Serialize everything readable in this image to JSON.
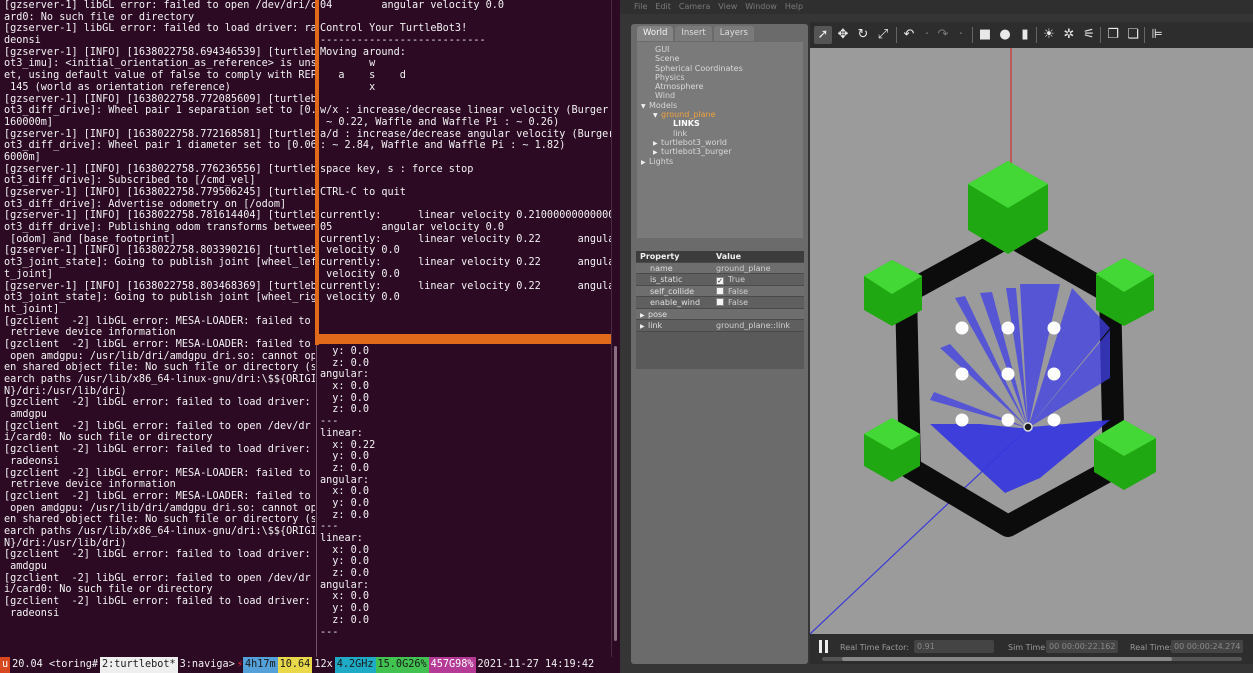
{
  "terminal": {
    "left_pane": [
      "[gzserver-1] libGL error: failed to open /dev/dri/c",
      "ard0: No such file or directory",
      "[gzserver-1] libGL error: failed to load driver: ra",
      "deonsi",
      "[gzserver-1] [INFO] [1638022758.694346539] [turtleb",
      "ot3_imu]: <initial_orientation_as_reference> is uns",
      "et, using default value of false to comply with REP",
      " 145 (world as orientation reference)",
      "[gzserver-1] [INFO] [1638022758.772085609] [turtleb",
      "ot3_diff_drive]: Wheel pair 1 separation set to [0.",
      "160000m]",
      "[gzserver-1] [INFO] [1638022758.772168581] [turtleb",
      "ot3_diff_drive]: Wheel pair 1 diameter set to [0.06",
      "6000m]",
      "[gzserver-1] [INFO] [1638022758.776236556] [turtleb",
      "ot3_diff_drive]: Subscribed to [/cmd_vel]",
      "[gzserver-1] [INFO] [1638022758.779506245] [turtleb",
      "ot3_diff_drive]: Advertise odometry on [/odom]",
      "[gzserver-1] [INFO] [1638022758.781614404] [turtleb",
      "ot3_diff_drive]: Publishing odom transforms between",
      " [odom] and [base_footprint]",
      "[gzserver-1] [INFO] [1638022758.803390216] [turtleb",
      "ot3_joint_state]: Going to publish joint [wheel_lef",
      "t_joint]",
      "[gzserver-1] [INFO] [1638022758.803468369] [turtleb",
      "ot3_joint_state]: Going to publish joint [wheel_rig",
      "ht_joint]",
      "[gzclient  -2] libGL error: MESA-LOADER: failed to",
      " retrieve device information",
      "[gzclient  -2] libGL error: MESA-LOADER: failed to",
      " open amdgpu: /usr/lib/dri/amdgpu_dri.so: cannot op",
      "en shared object file: No such file or directory (s",
      "earch paths /usr/lib/x86_64-linux-gnu/dri:\\$${ORIGI",
      "N}/dri:/usr/lib/dri)",
      "[gzclient  -2] libGL error: failed to load driver:",
      " amdgpu",
      "[gzclient  -2] libGL error: failed to open /dev/dr",
      "i/card0: No such file or directory",
      "[gzclient  -2] libGL error: failed to load driver:",
      " radeonsi",
      "[gzclient  -2] libGL error: MESA-LOADER: failed to",
      " retrieve device information",
      "[gzclient  -2] libGL error: MESA-LOADER: failed to",
      " open amdgpu: /usr/lib/dri/amdgpu_dri.so: cannot op",
      "en shared object file: No such file or directory (s",
      "earch paths /usr/lib/x86_64-linux-gnu/dri:\\$${ORIGI",
      "N}/dri:/usr/lib/dri)",
      "[gzclient  -2] libGL error: failed to load driver:",
      " amdgpu",
      "[gzclient  -2] libGL error: failed to open /dev/dr",
      "i/card0: No such file or directory",
      "[gzclient  -2] libGL error: failed to load driver:",
      " radeonsi"
    ],
    "right_top_pane": [
      "04        angular velocity 0.0",
      "",
      "Control Your TurtleBot3!",
      "---------------------------",
      "Moving around:",
      "        w",
      "   a    s    d",
      "        x",
      "",
      "w/x : increase/decrease linear velocity (Burger :",
      " ~ 0.22, Waffle and Waffle Pi : ~ 0.26)",
      "a/d : increase/decrease angular velocity (Burger",
      ": ~ 2.84, Waffle and Waffle Pi : ~ 1.82)",
      "",
      "space key, s : force stop",
      "",
      "CTRL-C to quit",
      "",
      "currently:      linear velocity 0.210000000000000",
      "05        angular velocity 0.0",
      "currently:      linear velocity 0.22      angular",
      " velocity 0.0",
      "currently:      linear velocity 0.22      angular",
      " velocity 0.0",
      "currently:      linear velocity 0.22      angular",
      " velocity 0.0"
    ],
    "right_bottom_pane": [
      "  y: 0.0",
      "  z: 0.0",
      "angular:",
      "  x: 0.0",
      "  y: 0.0",
      "  z: 0.0",
      "---",
      "linear:",
      "  x: 0.22",
      "  y: 0.0",
      "  z: 0.0",
      "angular:",
      "  x: 0.0",
      "  y: 0.0",
      "  z: 0.0",
      "---",
      "linear:",
      "  x: 0.0",
      "  y: 0.0",
      "  z: 0.0",
      "angular:",
      "  x: 0.0",
      "  y: 0.0",
      "  z: 0.0",
      "---"
    ],
    "status_bar": {
      "seg_u": "u",
      "seg_os": " 20.04 <toring# ",
      "seg_win2": "2:turtlebot*",
      "seg_win3": " 3:naviga>",
      "seg_arrow": "⚡",
      "seg_uptime": "4h17m",
      "seg_load": "10.64",
      "seg_cpu": " 12x",
      "seg_freq": "4.2GHz",
      "seg_mem": "15.0G26%",
      "seg_disk": "457G98%",
      "seg_date": " 2021-11-27 14:19:42"
    }
  },
  "gazebo": {
    "menubar": [
      "File",
      "Edit",
      "Camera",
      "View",
      "Window",
      "Help"
    ],
    "tabs": [
      "World",
      "Insert",
      "Layers"
    ],
    "tree": [
      {
        "label": "GUI",
        "indent": 1,
        "tri": ""
      },
      {
        "label": "Scene",
        "indent": 1,
        "tri": ""
      },
      {
        "label": "Spherical Coordinates",
        "indent": 1,
        "tri": ""
      },
      {
        "label": "Physics",
        "indent": 1,
        "tri": ""
      },
      {
        "label": "Atmosphere",
        "indent": 1,
        "tri": ""
      },
      {
        "label": "Wind",
        "indent": 1,
        "tri": ""
      },
      {
        "label": "Models",
        "indent": 0,
        "tri": "▼"
      },
      {
        "label": "ground_plane",
        "indent": 2,
        "tri": "▼",
        "cls": "sel"
      },
      {
        "label": "LINKS",
        "indent": 4,
        "tri": "",
        "cls": "bold"
      },
      {
        "label": "link",
        "indent": 4,
        "tri": ""
      },
      {
        "label": "turtlebot3_world",
        "indent": 2,
        "tri": "▶"
      },
      {
        "label": "turtlebot3_burger",
        "indent": 2,
        "tri": "▶"
      },
      {
        "label": "Lights",
        "indent": 0,
        "tri": "▶"
      }
    ],
    "properties": {
      "header_key": "Property",
      "header_value": "Value",
      "name_key": "name",
      "name_value": "ground_plane",
      "is_static_key": "is_static",
      "is_static_value": "True",
      "self_collide_key": "self_collide",
      "self_collide_value": "False",
      "enable_wind_key": "enable_wind",
      "enable_wind_value": "False",
      "pose_key": "pose",
      "link_key": "link",
      "link_value": "ground_plane::link"
    },
    "bottom": {
      "rtf_label": "Real Time Factor:",
      "rtf_value": "0.91",
      "sim_label": "Sim Time:",
      "sim_value": "00 00:00:22.162",
      "real_label": "Real Time:",
      "real_value": "00 00:00:24.274"
    },
    "colors": {
      "hex_green": "#22b818",
      "laser_blue": "#3232e6",
      "wall_black": "#111111",
      "ground_grey": "#9b9b9b"
    }
  }
}
